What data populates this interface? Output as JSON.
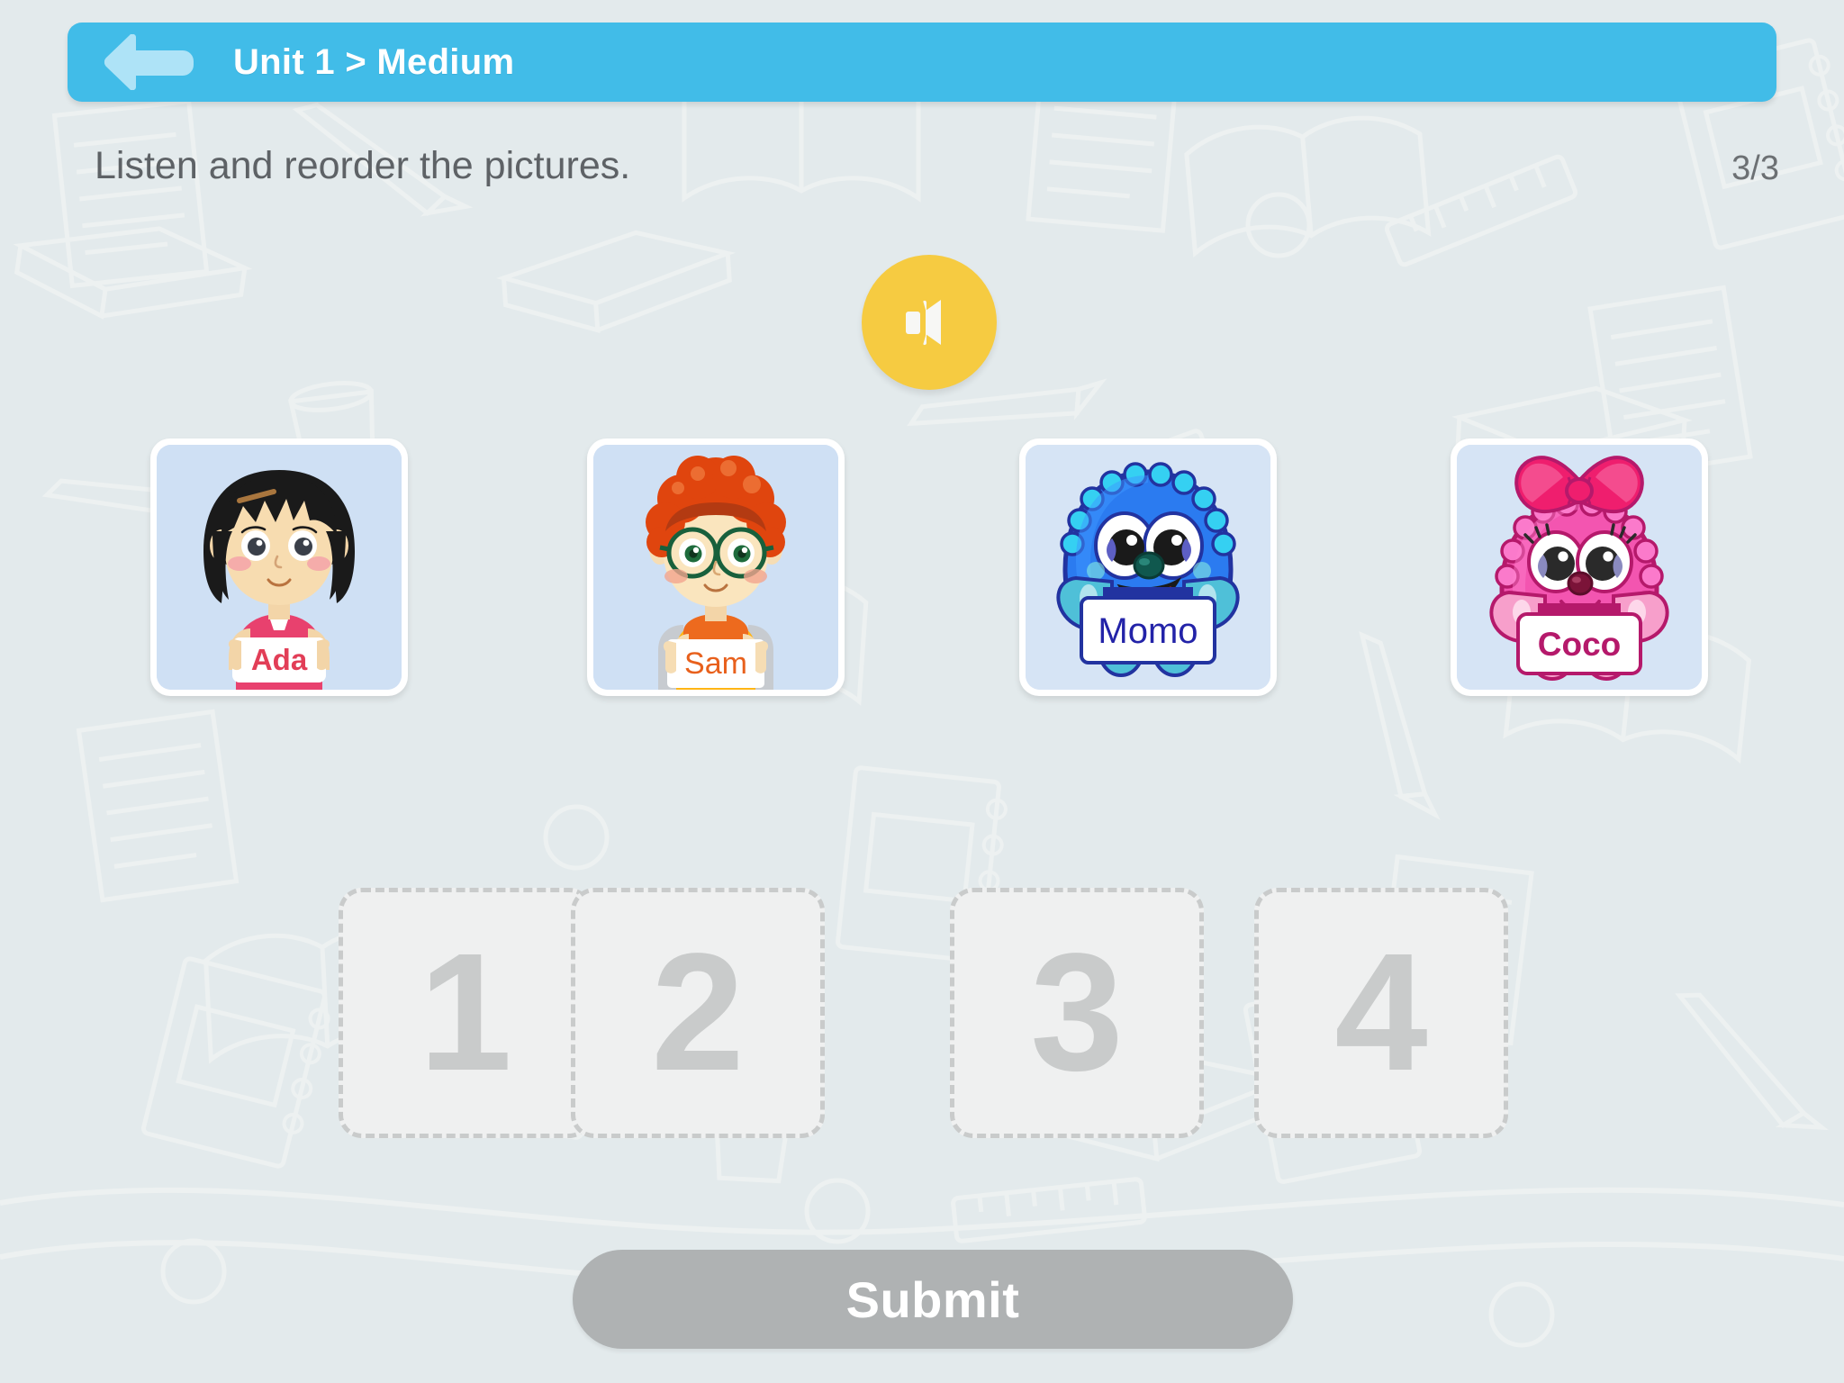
{
  "header": {
    "title": "Unit 1 > Medium",
    "back_icon": "back-arrow-icon"
  },
  "instruction": {
    "text": "Listen and reorder the pictures.",
    "progress": "3/3"
  },
  "audio": {
    "icon": "speaker-icon",
    "label": "Play audio"
  },
  "cards": [
    {
      "name": "Ada",
      "type": "girl-character",
      "card_bg": "#CFE0F4",
      "label_color": "#E23E57"
    },
    {
      "name": "Sam",
      "type": "boy-character",
      "card_bg": "#CFE0F4",
      "label_color": "#E8601C"
    },
    {
      "name": "Momo",
      "type": "blue-monster-character",
      "card_bg": "#D6E4F5",
      "label_color": "#2323A8"
    },
    {
      "name": "Coco",
      "type": "pink-monster-character",
      "card_bg": "#D6E4F5",
      "label_color": "#B5196B"
    }
  ],
  "slots": [
    {
      "number": "1"
    },
    {
      "number": "2"
    },
    {
      "number": "3"
    },
    {
      "number": "4"
    }
  ],
  "submit": {
    "label": "Submit"
  },
  "colors": {
    "page_bg": "#E3EAEC",
    "header_blue": "#41BCE8",
    "back_arrow": "#AEE3F7",
    "audio_yellow": "#F6CB41",
    "slot_fill": "#EFF0F0",
    "slot_border": "#C9CBCB",
    "submit_grey": "#AFB2B3",
    "text_grey": "#5E6266"
  }
}
